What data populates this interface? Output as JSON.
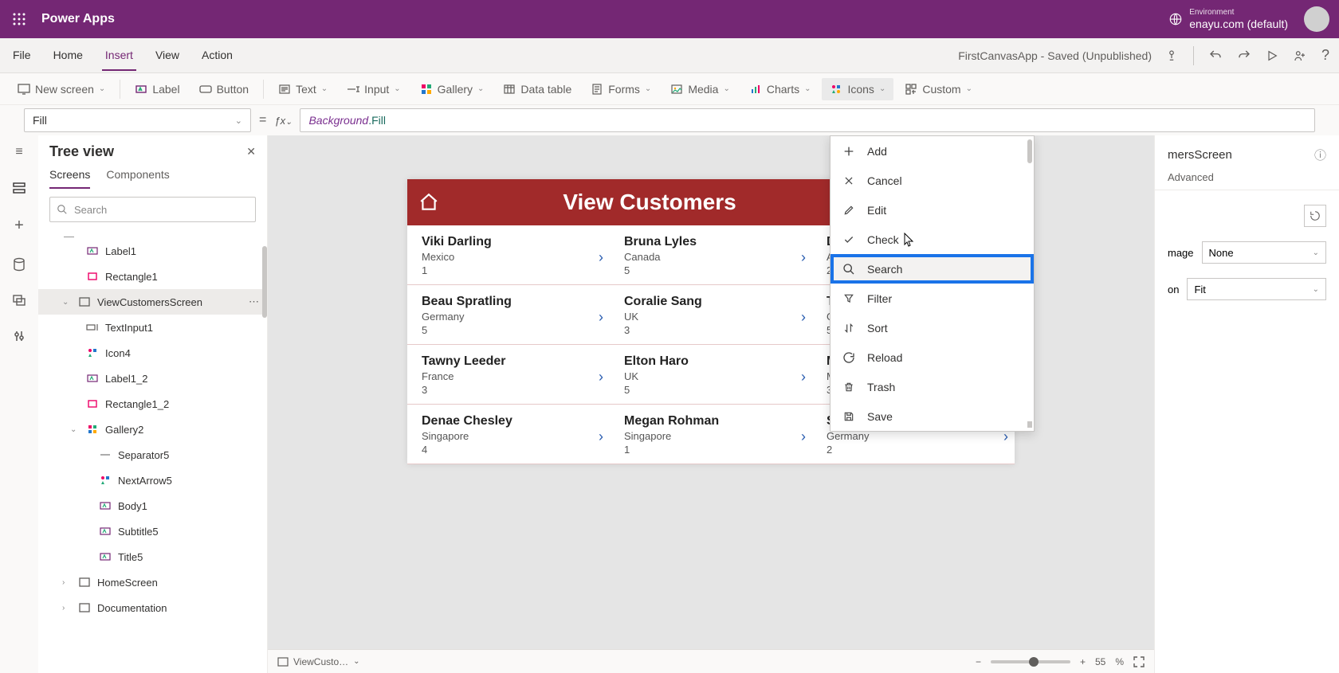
{
  "topbar": {
    "app_title": "Power Apps",
    "env_label": "Environment",
    "env_name": "enayu.com (default)"
  },
  "menu": {
    "items": [
      "File",
      "Home",
      "Insert",
      "View",
      "Action"
    ],
    "active": "Insert",
    "app_status": "FirstCanvasApp - Saved (Unpublished)"
  },
  "toolbar": {
    "new_screen": "New screen",
    "label": "Label",
    "button": "Button",
    "text": "Text",
    "input": "Input",
    "gallery": "Gallery",
    "data_table": "Data table",
    "forms": "Forms",
    "media": "Media",
    "charts": "Charts",
    "icons": "Icons",
    "custom": "Custom"
  },
  "formula": {
    "property": "Fill",
    "token1": "Background",
    "token2": ".Fill"
  },
  "tree": {
    "title": "Tree view",
    "tabs": [
      "Screens",
      "Components"
    ],
    "search_placeholder": "Search",
    "items": [
      {
        "label": "Label1",
        "depth": 1,
        "icon": "label"
      },
      {
        "label": "Rectangle1",
        "depth": 1,
        "icon": "rect"
      },
      {
        "label": "ViewCustomersScreen",
        "depth": 0,
        "icon": "screen",
        "sel": true,
        "expand": true
      },
      {
        "label": "TextInput1",
        "depth": 1,
        "icon": "input"
      },
      {
        "label": "Icon4",
        "depth": 1,
        "icon": "iconctl"
      },
      {
        "label": "Label1_2",
        "depth": 1,
        "icon": "label"
      },
      {
        "label": "Rectangle1_2",
        "depth": 1,
        "icon": "rect"
      },
      {
        "label": "Gallery2",
        "depth": 1,
        "icon": "gallery",
        "expand": true
      },
      {
        "label": "Separator5",
        "depth": 2,
        "icon": "sep"
      },
      {
        "label": "NextArrow5",
        "depth": 2,
        "icon": "iconctl"
      },
      {
        "label": "Body1",
        "depth": 2,
        "icon": "label"
      },
      {
        "label": "Subtitle5",
        "depth": 2,
        "icon": "label"
      },
      {
        "label": "Title5",
        "depth": 2,
        "icon": "label"
      },
      {
        "label": "HomeScreen",
        "depth": 0,
        "icon": "screen",
        "expand": false
      },
      {
        "label": "Documentation",
        "depth": 0,
        "icon": "screen",
        "expand": false
      }
    ]
  },
  "canvas": {
    "title": "View Customers",
    "rows": [
      [
        {
          "name": "Viki  Darling",
          "country": "Mexico",
          "num": "1"
        },
        {
          "name": "Bruna  Lyles",
          "country": "Canada",
          "num": "5"
        },
        {
          "name": "Daine  Zamora",
          "country": "Australia",
          "num": "2"
        }
      ],
      [
        {
          "name": "Beau  Spratling",
          "country": "Germany",
          "num": "5"
        },
        {
          "name": "Coralie  Sang",
          "country": "UK",
          "num": "3"
        },
        {
          "name": "Thresa  Milstead",
          "country": "Germany",
          "num": "5"
        }
      ],
      [
        {
          "name": "Tawny  Leeder",
          "country": "France",
          "num": "3"
        },
        {
          "name": "Elton  Haro",
          "country": "UK",
          "num": "5"
        },
        {
          "name": "Madaline  Neblett",
          "country": "Malayasia",
          "num": "3"
        }
      ],
      [
        {
          "name": "Denae  Chesley",
          "country": "Singapore",
          "num": "4"
        },
        {
          "name": "Megan  Rohman",
          "country": "Singapore",
          "num": "1"
        },
        {
          "name": "Sonya  Rebello",
          "country": "Germany",
          "num": "2"
        }
      ]
    ]
  },
  "icons_dropdown": {
    "items": [
      "Add",
      "Cancel",
      "Edit",
      "Check",
      "Search",
      "Filter",
      "Sort",
      "Reload",
      "Trash",
      "Save"
    ],
    "highlight": "Search"
  },
  "propspanel": {
    "title_suffix": "mersScreen",
    "tab_advanced": "Advanced",
    "row1_label": "mage",
    "row1_value": "None",
    "row2_label": "on",
    "row2_value": "Fit"
  },
  "statusbar": {
    "crumb": "ViewCusto…",
    "zoom": "55",
    "zoom_pct": "%"
  }
}
